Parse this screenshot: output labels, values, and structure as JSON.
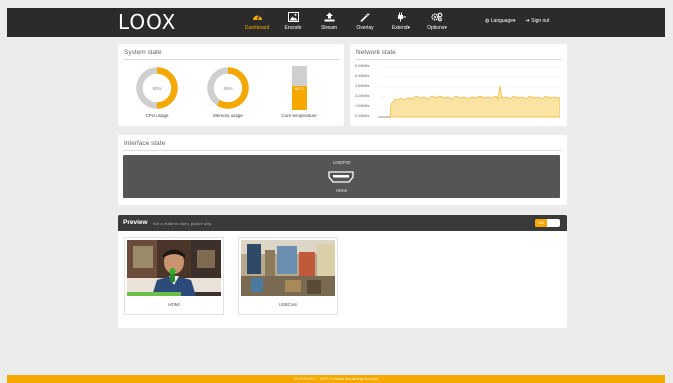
{
  "brand": {
    "logo": "LOOX"
  },
  "nav": {
    "items": [
      {
        "label": "Dashboard",
        "icon": "dashboard-icon",
        "active": true
      },
      {
        "label": "Encode",
        "icon": "image-icon",
        "active": false
      },
      {
        "label": "Stream",
        "icon": "upload-icon",
        "active": false
      },
      {
        "label": "Overlay",
        "icon": "magic-wand-icon",
        "active": false
      },
      {
        "label": "Extend",
        "icon": "plug-icon",
        "active": false
      },
      {
        "label": "Options",
        "icon": "gears-icon",
        "active": false
      }
    ],
    "language": "Language",
    "signout": "Sign out"
  },
  "system_state": {
    "title": "System state",
    "cpu": {
      "value": "50%",
      "label": "CPU usage",
      "fraction": 0.5
    },
    "memory": {
      "value": "59%",
      "label": "Memory usage",
      "fraction": 0.59
    },
    "temperature": {
      "value": "60°C",
      "label": "Core temperature",
      "fraction": 0.55
    }
  },
  "network_state": {
    "title": "Network state",
    "y_ticks": [
      "8.00Mb/s",
      "6.40Mb/s",
      "4.80Mb/s",
      "3.20Mb/s",
      "1.60Mb/s",
      "0.00Mb/s"
    ]
  },
  "interface_state": {
    "title": "Interface state",
    "resolution": "1080P30",
    "port": "HDMI"
  },
  "preview": {
    "title": "Preview",
    "subtitle": "Not a realtime video, picture only.",
    "toggle": "ON",
    "sources": [
      {
        "label": "HDMI"
      },
      {
        "label": "USBCam"
      }
    ]
  },
  "footer": {
    "text": "©LOOX2017 · WiFi Portable streaming encoder"
  },
  "colors": {
    "accent": "#f5a800",
    "topbar": "#2b2b2b"
  }
}
